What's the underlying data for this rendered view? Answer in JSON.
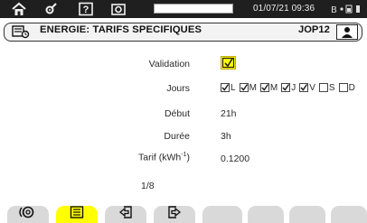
{
  "status_bar": {
    "icons": [
      "home-icon",
      "settings-icon",
      "help-icon",
      "camera-icon"
    ],
    "progress_fraction": 1.0,
    "datetime": "01/07/21 09:36",
    "battery_text": "B ∘ ▒ ▮"
  },
  "header": {
    "icon": "tariff-screen-icon",
    "title": "ENERGIE: TARIFS SPECIFIQUES",
    "code": "JOP12",
    "user_icon": "user-icon"
  },
  "form": {
    "validation_label": "Validation",
    "validation_checked": true,
    "days_label": "Jours",
    "days": [
      {
        "letter": "L",
        "checked": true
      },
      {
        "letter": "M",
        "checked": true
      },
      {
        "letter": "M",
        "checked": true
      },
      {
        "letter": "J",
        "checked": true
      },
      {
        "letter": "V",
        "checked": true
      },
      {
        "letter": "S",
        "checked": false
      },
      {
        "letter": "D",
        "checked": false
      }
    ],
    "start_label": "Début",
    "start_value": "21h",
    "duration_label": "Durée",
    "duration_value": "3h",
    "tariff_label_main": "Tarif (kWh",
    "tariff_label_sup": "-1",
    "tariff_label_close": ")",
    "tariff_value": "0.1200",
    "page": "1/8"
  },
  "tabs": [
    {
      "icon": "circle-zero-icon",
      "active": false
    },
    {
      "icon": "list-icon",
      "active": true
    },
    {
      "icon": "previous-icon",
      "active": false
    },
    {
      "icon": "next-icon",
      "active": false
    },
    {
      "icon": "empty",
      "active": false
    },
    {
      "icon": "empty",
      "active": false
    },
    {
      "icon": "empty",
      "active": false
    },
    {
      "icon": "empty",
      "active": false
    }
  ],
  "colors": {
    "accent_yellow": "#ffff00",
    "tab_gray": "#d9d9d9",
    "topbar": "#1f1f1f"
  }
}
